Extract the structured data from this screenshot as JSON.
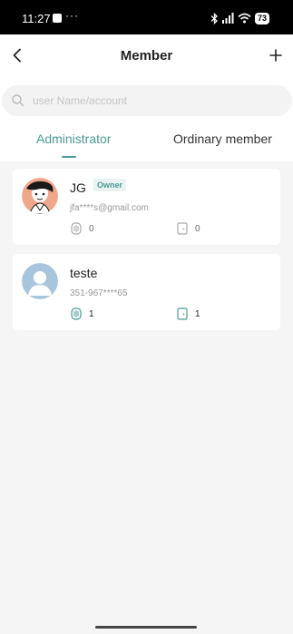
{
  "status": {
    "time": "11:27",
    "dots": "···",
    "battery": "73"
  },
  "header": {
    "title": "Member"
  },
  "search": {
    "placeholder": "user Name/account"
  },
  "tabs": [
    {
      "label": "Administrator",
      "active": true
    },
    {
      "label": "Ordinary member",
      "active": false
    }
  ],
  "members": [
    {
      "name": "JG",
      "badge": "Owner",
      "account": "jfa****s@gmail.com",
      "fingerprint_count": "0",
      "card_count": "0"
    },
    {
      "name": "teste",
      "account": "351-967****65",
      "fingerprint_count": "1",
      "card_count": "1"
    }
  ],
  "colors": {
    "accent": "#4c9a96",
    "badge_bg": "#e8f3f2",
    "avatar_blue": "#a7c6de",
    "avatar_peach": "#f1a68c"
  }
}
